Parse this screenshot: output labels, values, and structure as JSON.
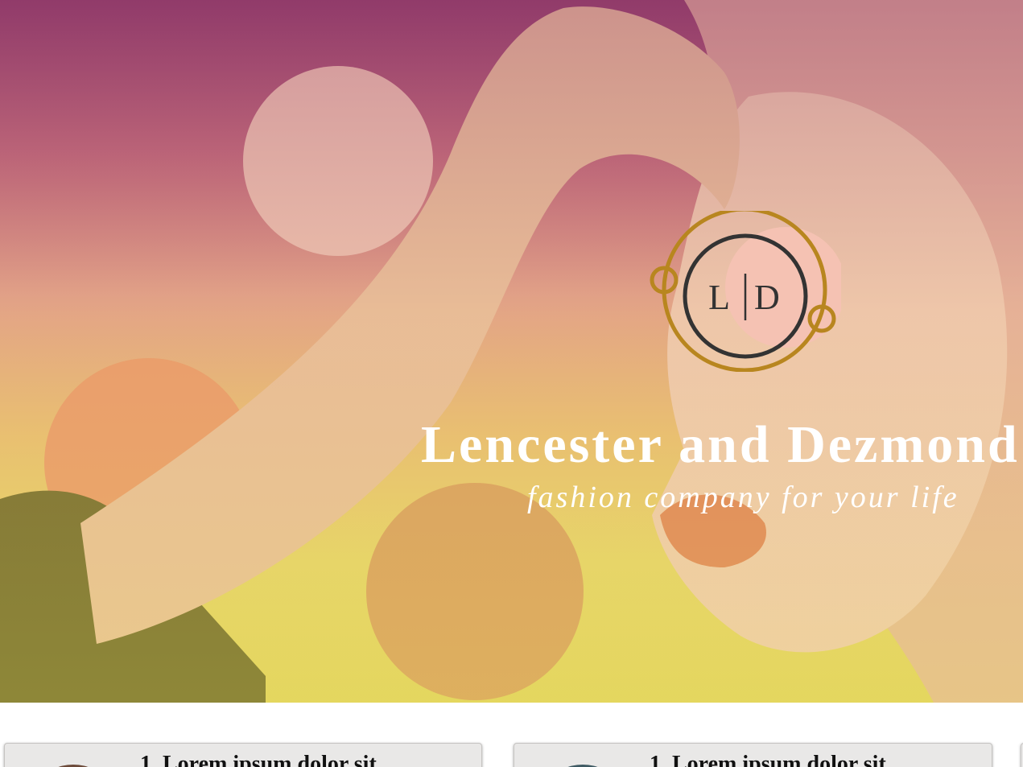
{
  "hero": {
    "logo": {
      "left_letter": "L",
      "right_letter": "D"
    },
    "title": "Lencester and Dezmond",
    "tagline": "fashion company for your life"
  },
  "cards": [
    {
      "title": "1. Lorem ipsum dolor sit"
    },
    {
      "title": "1. Lorem ipsum dolor sit"
    }
  ],
  "colors": {
    "logo_gold": "#b8861f",
    "logo_pink": "#f5c2b3",
    "logo_dark": "#333333",
    "card_bg": "#e9e8e7"
  }
}
